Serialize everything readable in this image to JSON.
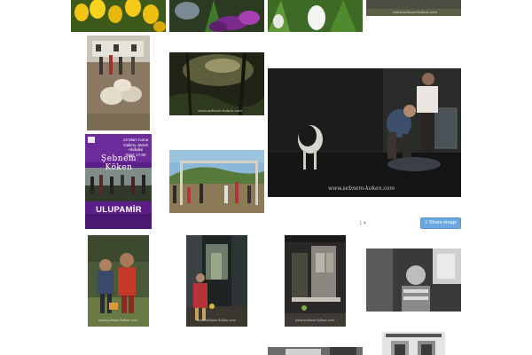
{
  "gallery": {
    "watermark": "www.sebnem-koken.com",
    "share_button_label": "Share image",
    "share_icon": "share-icon",
    "image_counter": "1 ▾",
    "poster": {
      "date_line1": "13 Mart Cuma",
      "date_line2": "Gallery Jamal Abdullai",
      "date_line3": "Saat: 17:00",
      "title": "Şebnem Köken",
      "subtitle": "ULUPAMİR"
    }
  }
}
